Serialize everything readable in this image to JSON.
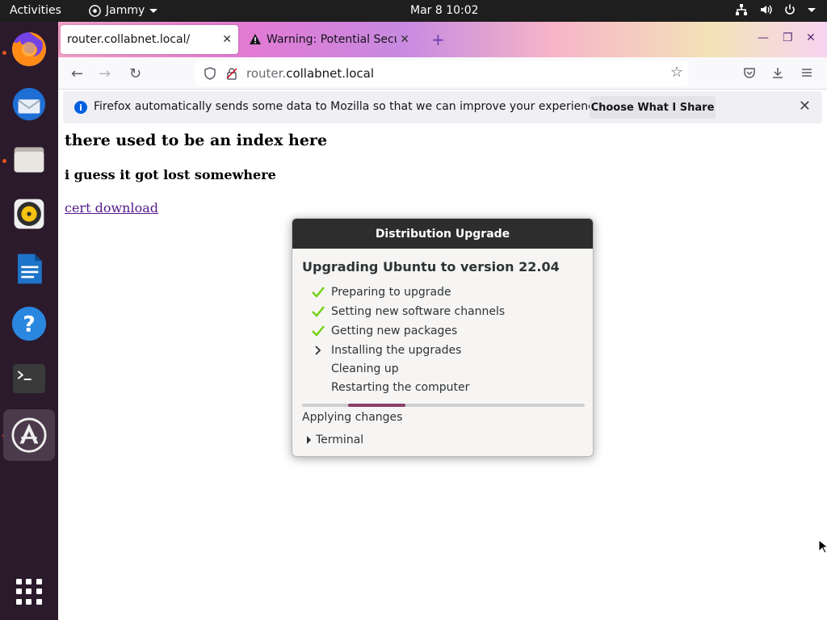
{
  "topbar": {
    "activities": "Activities",
    "app_name": "Jammy",
    "clock": "Mar 8  10:02"
  },
  "dock": {
    "items": [
      "firefox-icon",
      "thunderbird-icon",
      "files-icon",
      "rhythmbox-icon",
      "writer-icon",
      "help-icon",
      "terminal-icon",
      "software-updater-icon"
    ]
  },
  "browser": {
    "tabs": [
      {
        "title": "router.collabnet.local/"
      },
      {
        "title": "Warning: Potential Secur"
      }
    ],
    "url": {
      "scheme_host": "router.",
      "domain": "collabnet.local"
    },
    "notice": {
      "message": "Firefox automatically sends some data to Mozilla so that we can improve your experience.",
      "button": "Choose What I Share"
    }
  },
  "page": {
    "heading": "there used to be an index here",
    "subheading": "i guess it got lost somewhere",
    "link": "cert download"
  },
  "dialog": {
    "title": "Distribution Upgrade",
    "heading": "Upgrading Ubuntu to version 22.04",
    "steps": [
      {
        "label": "Preparing to upgrade",
        "state": "done"
      },
      {
        "label": "Setting new software channels",
        "state": "done"
      },
      {
        "label": "Getting new packages",
        "state": "done"
      },
      {
        "label": "Installing the upgrades",
        "state": "current"
      },
      {
        "label": "Cleaning up",
        "state": "pending"
      },
      {
        "label": "Restarting the computer",
        "state": "pending"
      }
    ],
    "status": "Applying changes",
    "terminal_label": "Terminal",
    "accent_color": "#8a3f68"
  }
}
